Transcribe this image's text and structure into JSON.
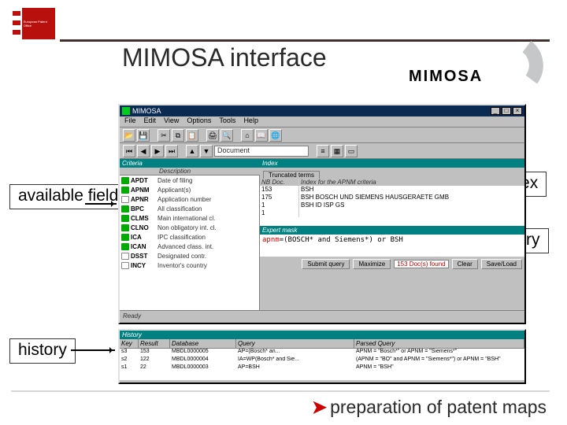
{
  "header": {
    "logo_text": "European Patent Office",
    "title": "MIMOSA interface",
    "brand": "MIMOSA"
  },
  "callouts": {
    "available_fields": "available fields",
    "index": "index",
    "query": "query",
    "history": "history"
  },
  "app": {
    "window_title": "MIMOSA",
    "menus": [
      "File",
      "Edit",
      "View",
      "Options",
      "Tools",
      "Help"
    ],
    "docfield_label": "Document",
    "statusbar": "Ready",
    "criteria": {
      "pane_label": "Criteria",
      "col_code": "",
      "col_desc": "Description",
      "rows": [
        {
          "code": "APDT",
          "desc": "Date of filing",
          "badge": "g"
        },
        {
          "code": "APNM",
          "desc": "Applicant(s)",
          "badge": "g"
        },
        {
          "code": "APNR",
          "desc": "Application number",
          "badge": "w"
        },
        {
          "code": "BPC",
          "desc": "All classification",
          "badge": "g"
        },
        {
          "code": "CLMS",
          "desc": "Main international cl.",
          "badge": "g"
        },
        {
          "code": "CLNO",
          "desc": "Non obligatory int. cl.",
          "badge": "g"
        },
        {
          "code": "ICA",
          "desc": "IPC classification",
          "badge": "g"
        },
        {
          "code": "ICAN",
          "desc": "Advanced class. int.",
          "badge": "g"
        },
        {
          "code": "DSST",
          "desc": "Designated contr.",
          "badge": "w"
        },
        {
          "code": "INCY",
          "desc": "Inventor's country",
          "badge": "w"
        }
      ]
    },
    "index": {
      "pane_label": "Index",
      "tab_label": "Truncated terms",
      "col1": "NB Doc.",
      "col2": "Index for the APNM criteria",
      "rows": [
        {
          "n": "153",
          "text": "BSH"
        },
        {
          "n": "175",
          "text": "BSH BOSCH UND SIEMENS HAUSGERAETE GMB"
        },
        {
          "n": "1",
          "text": "BSH ID ISP GS"
        },
        {
          "n": "1",
          "text": ""
        }
      ]
    },
    "expert": {
      "pane_label": "Expert mask",
      "query_key": "apnm",
      "query_rest": "=(BOSCH* and Siemens*) or BSH",
      "buttons": {
        "submit": "Submit query",
        "maximize": "Maximize",
        "found": "153 Doc(s) found",
        "clear": "Clear",
        "save": "Save/Load"
      }
    }
  },
  "history": {
    "pane_label": "History",
    "cols": [
      "Key",
      "Result",
      "Database",
      "Query",
      "Parsed Query"
    ],
    "rows": [
      {
        "key": "s3",
        "result": "153",
        "db": "MBDL0000005",
        "q": "AP=(Bosch* an...",
        "pq": "APNM = \"Bosch*\" or APNM = \"Siemens*\""
      },
      {
        "key": "s2",
        "result": "122",
        "db": "MBDL0000004",
        "q": "IA=WP(Bosch* and Sie...",
        "pq": "(APNM = \"BO\" and APNM = \"Siemens*\") or APNM = \"BSH\""
      },
      {
        "key": "s1",
        "result": "22",
        "db": "MBDL0000003",
        "q": "AP=BSH",
        "pq": "APNM = \"BSH\""
      }
    ]
  },
  "footer": {
    "text": "preparation of patent maps"
  }
}
